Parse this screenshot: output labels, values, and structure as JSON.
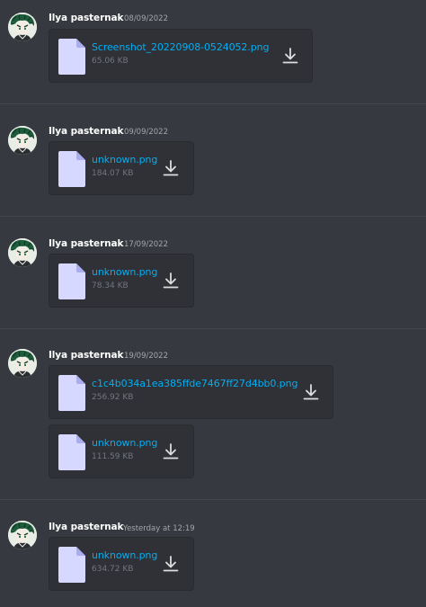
{
  "messages": [
    {
      "username": "Ilya pasternak",
      "timestamp": "08/09/2022",
      "attachments": [
        {
          "filename": "Screenshot_20220908-0524052.png",
          "size": "65.06 KB"
        }
      ]
    },
    {
      "username": "Ilya pasternak",
      "timestamp": "09/09/2022",
      "attachments": [
        {
          "filename": "unknown.png",
          "size": "184.07 KB"
        }
      ]
    },
    {
      "username": "Ilya pasternak",
      "timestamp": "17/09/2022",
      "attachments": [
        {
          "filename": "unknown.png",
          "size": "78.34 KB"
        }
      ]
    },
    {
      "username": "Ilya pasternak",
      "timestamp": "19/09/2022",
      "attachments": [
        {
          "filename": "c1c4b034a1ea385ffde7467ff27d4bb0.png",
          "size": "256.92 KB"
        },
        {
          "filename": "unknown.png",
          "size": "111.59 KB"
        }
      ]
    },
    {
      "username": "Ilya pasternak",
      "timestamp": "Yesterday at 12:19",
      "attachments": [
        {
          "filename": "unknown.png",
          "size": "634.72 KB"
        }
      ]
    }
  ],
  "colors": {
    "background": "#36393f",
    "attachment_bg": "#2f3136",
    "link": "#00aff4",
    "muted": "#72767d",
    "file_icon": "#d6d8ff"
  },
  "icons": {
    "avatar": "avatar-icon",
    "file": "file-icon",
    "download": "download-icon"
  }
}
